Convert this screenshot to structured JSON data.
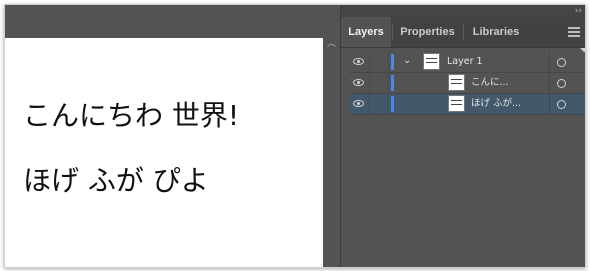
{
  "document": {
    "line1": "こんにちわ 世界!",
    "line2": "ほげ ふが ぴよ"
  },
  "panel": {
    "tabs": [
      {
        "label": "Layers",
        "active": true
      },
      {
        "label": "Properties",
        "active": false
      },
      {
        "label": "Libraries",
        "active": false
      }
    ],
    "layers": [
      {
        "label": "Layer 1",
        "type": "layer",
        "expanded": true
      },
      {
        "label": "こんに...",
        "type": "text"
      },
      {
        "label": "ほげ ふが...",
        "type": "text",
        "selected": true
      }
    ]
  },
  "colors": {
    "layer_color": "#4d86e6",
    "selection": "#43596b",
    "panel_bg": "#535353"
  },
  "icons": [
    "visibility-eye-icon",
    "chevron-down-icon",
    "target-circle-icon",
    "panel-menu-icon",
    "collapse-arrows-icon",
    "scroll-up-icon"
  ]
}
